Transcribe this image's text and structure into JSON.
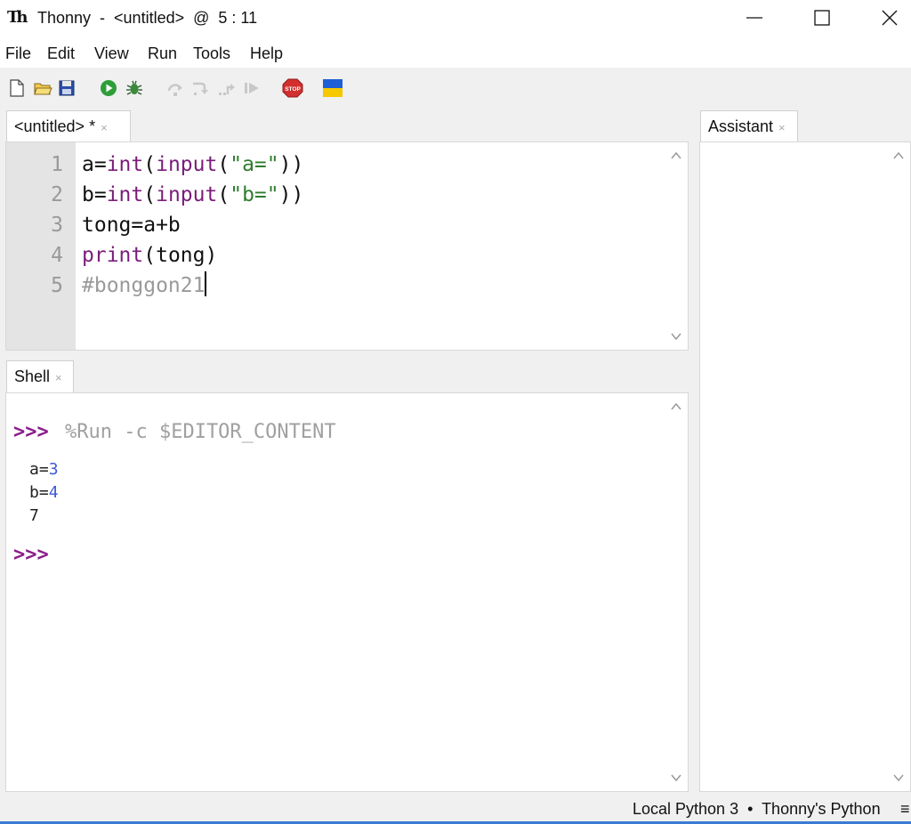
{
  "window": {
    "title": "Thonny  -  <untitled>  @  5 : 11",
    "logo_text": "Th"
  },
  "menu": [
    "File",
    "Edit",
    "View",
    "Run",
    "Tools",
    "Help"
  ],
  "toolbar": {
    "icons": [
      "new-file-icon",
      "open-file-icon",
      "save-file-icon",
      "run-icon",
      "debug-icon",
      "step-over-icon",
      "step-into-icon",
      "step-out-icon",
      "resume-icon",
      "stop-icon",
      "ukraine-flag-icon"
    ],
    "stop_label": "STOP"
  },
  "editor": {
    "tab_label": "<untitled> *",
    "tab_close": "×",
    "line_numbers": [
      "1",
      "2",
      "3",
      "4",
      "5"
    ],
    "lines": {
      "l1": {
        "a": "a=",
        "b": "int",
        "c": "(",
        "d": "input",
        "e": "(",
        "f": "\"a=\"",
        "g": "))"
      },
      "l2": {
        "a": "b=",
        "b": "int",
        "c": "(",
        "d": "input",
        "e": "(",
        "f": "\"b=\"",
        "g": "))"
      },
      "l3": "tong=a+b",
      "l4": {
        "a": "print",
        "b": "(tong)"
      },
      "l5": "#bonggon21"
    }
  },
  "shell": {
    "tab_label": "Shell",
    "tab_close": "×",
    "prompt": ">>>",
    "command": "%Run -c $EDITOR_CONTENT",
    "output": [
      {
        "label": "a=",
        "value": "3"
      },
      {
        "label": "b=",
        "value": "4"
      },
      {
        "label": "7",
        "value": ""
      }
    ]
  },
  "assistant": {
    "tab_label": "Assistant",
    "tab_close": "×"
  },
  "status": {
    "interpreter": "Local Python 3  •  Thonny's Python",
    "menu_icon": "≡"
  },
  "colors": {
    "builtin": "#7a1d7a",
    "string": "#2f7d2f",
    "comment": "#9a9a9a",
    "prompt": "#8b1a8b",
    "shell_input": "#3a5bd6"
  }
}
